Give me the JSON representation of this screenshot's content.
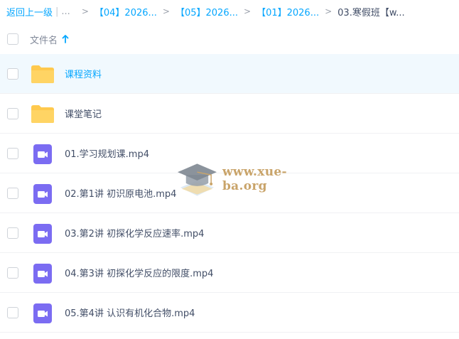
{
  "breadcrumb": {
    "back": "返回上一级",
    "pipe": "|",
    "ellipsis": "...",
    "separator": ">",
    "items": [
      "【04】2026...",
      "【05】2026...",
      "【01】2026..."
    ],
    "current": "03.寒假班【w..."
  },
  "header": {
    "name_label": "文件名",
    "sort_icon": "arrow-up-icon"
  },
  "files": [
    {
      "name": "课程资料",
      "icon": "folder-icon"
    },
    {
      "name": "课堂笔记",
      "icon": "folder-icon"
    },
    {
      "name": "01.学习规划课.mp4",
      "icon": "video-icon"
    },
    {
      "name": "02.第1讲 初识原电池.mp4",
      "icon": "video-icon"
    },
    {
      "name": "03.第2讲 初探化学反应速率.mp4",
      "icon": "video-icon"
    },
    {
      "name": "04.第3讲 初探化学反应的限度.mp4",
      "icon": "video-icon"
    },
    {
      "name": "05.第4讲 认识有机化合物.mp4",
      "icon": "video-icon"
    }
  ],
  "watermark": {
    "text": "www.xue-ba.org",
    "icon": "graduation-cap-logo"
  },
  "colors": {
    "accent": "#06a7ff",
    "folder": "#ffc94d",
    "video": "#7b6cf2",
    "active_row": "#f1f9fe"
  }
}
